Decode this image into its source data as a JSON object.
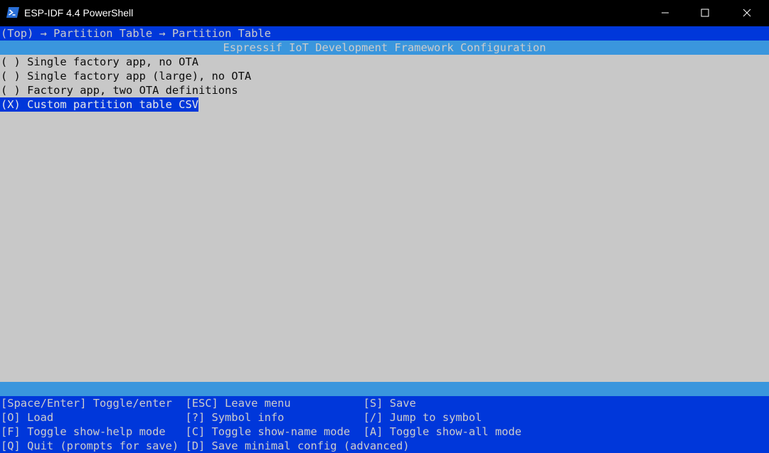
{
  "window": {
    "title": "ESP-IDF 4.4 PowerShell"
  },
  "menu": {
    "breadcrumb": "(Top) → Partition Table → Partition Table",
    "header": "Espressif IoT Development Framework Configuration",
    "options": [
      {
        "text": "( ) Single factory app, no OTA",
        "selected": false
      },
      {
        "text": "( ) Single factory app (large), no OTA",
        "selected": false
      },
      {
        "text": "( ) Factory app, two OTA definitions",
        "selected": false
      },
      {
        "text": "(X) Custom partition table CSV",
        "selected": true
      }
    ]
  },
  "help": {
    "lines": [
      "[Space/Enter] Toggle/enter  [ESC] Leave menu           [S] Save",
      "[O] Load                    [?] Symbol info            [/] Jump to symbol",
      "[F] Toggle show-help mode   [C] Toggle show-name mode  [A] Toggle show-all mode",
      "[Q] Quit (prompts for save) [D] Save minimal config (advanced)"
    ]
  },
  "colors": {
    "titlebar": "#000000",
    "breadcrumb_bg": "#0037da",
    "header_bg": "#3a96dd",
    "content_bg": "#c8c8c8",
    "selected_bg": "#0037da",
    "help_bg": "#0037da"
  },
  "icons": {
    "app": "powershell-icon",
    "minimize": "minimize-icon",
    "maximize": "maximize-icon",
    "close": "close-icon"
  }
}
